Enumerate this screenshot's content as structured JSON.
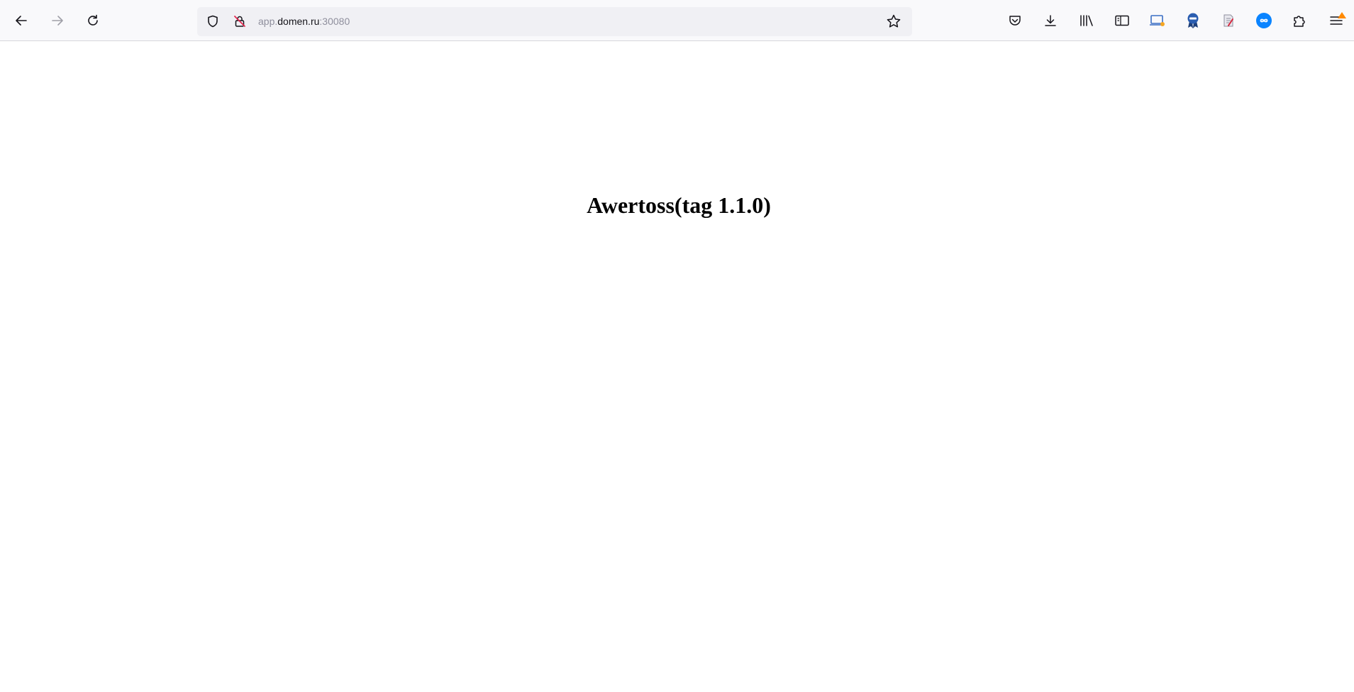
{
  "browser": {
    "address_bar": {
      "url_prefix": "app.",
      "url_host": "domen.ru",
      "url_suffix": ":30080"
    },
    "toolbar_icons": {
      "back": "back-arrow-icon",
      "forward": "forward-arrow-icon",
      "reload": "reload-icon",
      "tracking_protection": "shield-icon",
      "insecure_connection": "insecure-lock-icon",
      "bookmark": "star-icon",
      "pocket": "pocket-icon",
      "downloads": "download-icon",
      "library": "library-icon",
      "sidebar": "sidebar-icon",
      "extension_1": "screen-extension-icon",
      "extension_2": "ribbon-badge-extension-icon",
      "extension_3": "document-pen-extension-icon",
      "extension_4": "infinity-extension-icon",
      "extensions": "puzzle-icon",
      "menu": "hamburger-menu-icon"
    },
    "colors": {
      "toolbar_bg": "#f9f9fb",
      "urlbar_bg": "#f0f0f4",
      "icon": "#15141a",
      "icon_disabled": "#a0a0a8",
      "insecure_slash": "#e22850",
      "menu_badge": "#ff8a00",
      "extension_blue": "#0a84ff"
    }
  },
  "page": {
    "heading": "Awertoss(tag 1.1.0)"
  }
}
